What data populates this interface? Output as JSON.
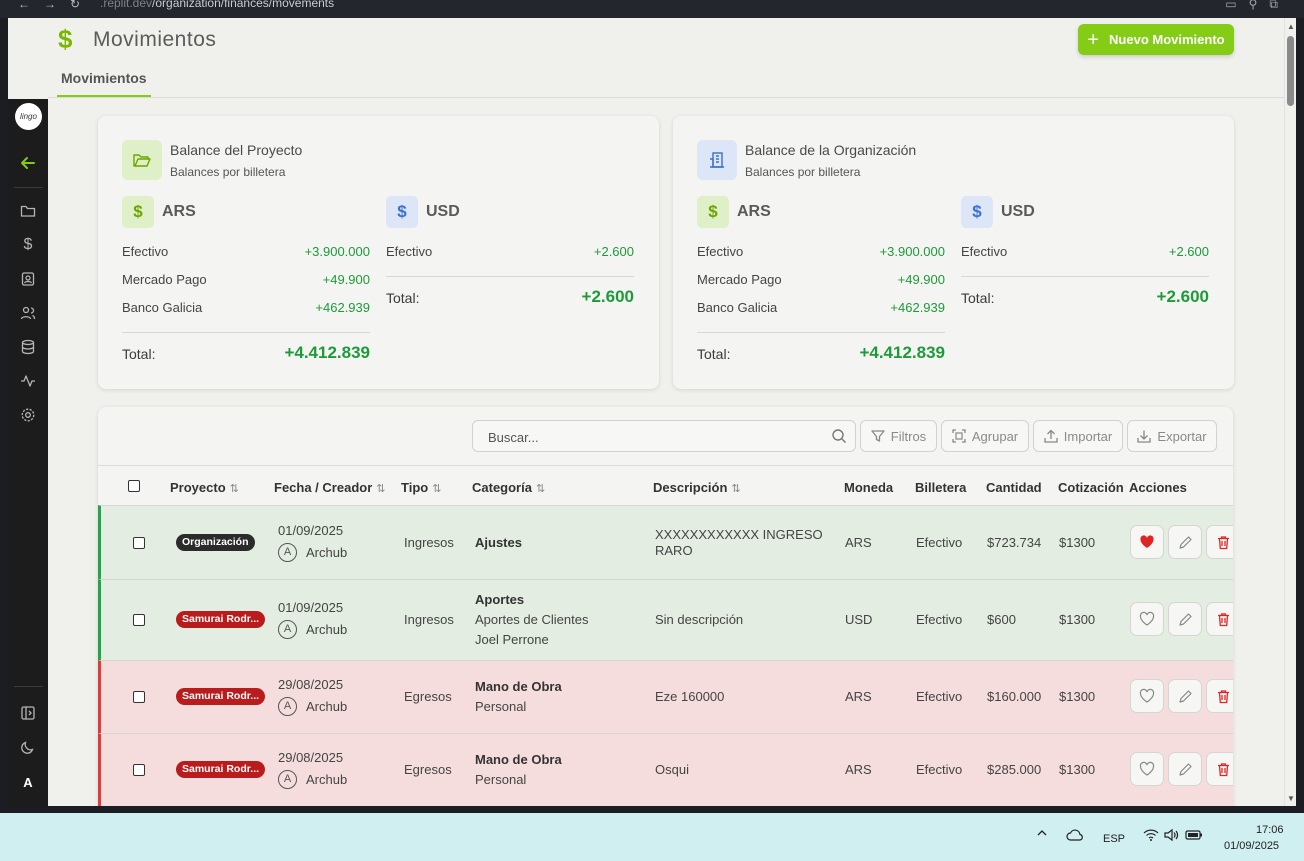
{
  "browser": {
    "url_prefix": ".replit.dev",
    "url_path": "/organization/finances/movements"
  },
  "header": {
    "title": "Movimientos",
    "new_button": "Nuevo Movimiento",
    "tab": "Movimientos"
  },
  "sidebar": {
    "logo_text": "lingo",
    "items": [
      "back-arrow-icon",
      "folder-icon",
      "dollar-icon",
      "contact-icon",
      "users-icon",
      "database-icon",
      "activity-icon",
      "gear-icon"
    ],
    "bottom": [
      "panel-icon",
      "moon-icon"
    ],
    "user_initial": "A"
  },
  "project_card": {
    "title": "Balance del Proyecto",
    "subtitle": "Balances por billetera",
    "ars": {
      "label": "ARS",
      "rows": [
        {
          "name": "Efectivo",
          "value": "+3.900.000"
        },
        {
          "name": "Mercado Pago",
          "value": "+49.900"
        },
        {
          "name": "Banco Galicia",
          "value": "+462.939"
        }
      ],
      "total_label": "Total:",
      "total": "+4.412.839"
    },
    "usd": {
      "label": "USD",
      "rows": [
        {
          "name": "Efectivo",
          "value": "+2.600"
        }
      ],
      "total_label": "Total:",
      "total": "+2.600"
    }
  },
  "org_card": {
    "title": "Balance de la Organización",
    "subtitle": "Balances por billetera",
    "ars": {
      "label": "ARS",
      "rows": [
        {
          "name": "Efectivo",
          "value": "+3.900.000"
        },
        {
          "name": "Mercado Pago",
          "value": "+49.900"
        },
        {
          "name": "Banco Galicia",
          "value": "+462.939"
        }
      ],
      "total_label": "Total:",
      "total": "+4.412.839"
    },
    "usd": {
      "label": "USD",
      "rows": [
        {
          "name": "Efectivo",
          "value": "+2.600"
        }
      ],
      "total_label": "Total:",
      "total": "+2.600"
    }
  },
  "toolbar": {
    "search_placeholder": "Buscar...",
    "filters": "Filtros",
    "group": "Agrupar",
    "import": "Importar",
    "export": "Exportar"
  },
  "table": {
    "headers": {
      "project": "Proyecto",
      "date": "Fecha / Creador",
      "type": "Tipo",
      "category": "Categoría",
      "description": "Descripción",
      "currency": "Moneda",
      "wallet": "Billetera",
      "amount": "Cantidad",
      "rate": "Cotización",
      "actions": "Acciones"
    },
    "rows": [
      {
        "kind": "in",
        "project": "Organización",
        "project_style": "org",
        "date": "01/09/2025",
        "creator_initial": "A",
        "creator": "Archub",
        "type": "Ingresos",
        "category": "Ajustes",
        "subcategory": "",
        "subsub": "",
        "description": "XXXXXXXXXXXX INGRESO",
        "description2": "RARO",
        "currency": "ARS",
        "wallet": "Efectivo",
        "amount": "$723.734",
        "rate": "$1300",
        "favorite": true
      },
      {
        "kind": "in",
        "project": "Samurai Rodr...",
        "project_style": "sam",
        "date": "01/09/2025",
        "creator_initial": "A",
        "creator": "Archub",
        "type": "Ingresos",
        "category": "Aportes",
        "subcategory": "Aportes de Clientes",
        "subsub": "Joel Perrone",
        "description": "Sin descripción",
        "description2": "",
        "currency": "USD",
        "wallet": "Efectivo",
        "amount": "$600",
        "rate": "$1300",
        "favorite": false
      },
      {
        "kind": "out",
        "project": "Samurai Rodr...",
        "project_style": "sam",
        "date": "29/08/2025",
        "creator_initial": "A",
        "creator": "Archub",
        "type": "Egresos",
        "category": "Mano de Obra",
        "subcategory": "Personal",
        "subsub": "",
        "description": "Eze 160000",
        "description2": "",
        "currency": "ARS",
        "wallet": "Efectivo",
        "amount": "$160.000",
        "rate": "$1300",
        "favorite": false
      },
      {
        "kind": "out",
        "project": "Samurai Rodr...",
        "project_style": "sam",
        "date": "29/08/2025",
        "creator_initial": "A",
        "creator": "Archub",
        "type": "Egresos",
        "category": "Mano de Obra",
        "subcategory": "Personal",
        "subsub": "",
        "description": "Osqui",
        "description2": "",
        "currency": "ARS",
        "wallet": "Efectivo",
        "amount": "$285.000",
        "rate": "$1300",
        "favorite": false
      }
    ]
  },
  "taskbar": {
    "lang": "ESP",
    "time": "17:06",
    "date": "01/09/2025"
  },
  "colors": {
    "accent": "#84cc16",
    "income": "#22a64a",
    "expense": "#e03a3a",
    "positive_text": "#1f9a3a"
  }
}
